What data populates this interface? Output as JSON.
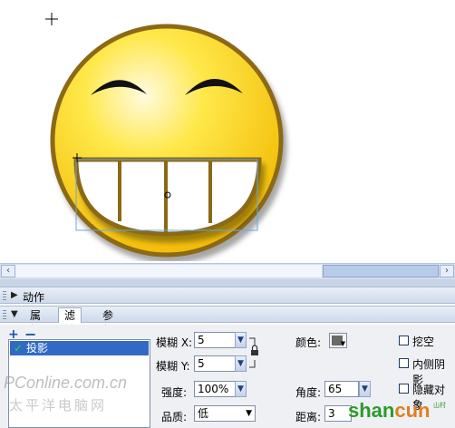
{
  "stage": {
    "selection_color": "#6aa9d9",
    "face_color": "#ffd700",
    "outline_color": "#8b6914"
  },
  "icons": {
    "crosshair": "crosshair-icon",
    "lock": "lock-icon"
  },
  "scrollbar": {
    "left_arrow": "‹",
    "right_arrow": "›"
  },
  "actions_panel": {
    "title": "动作"
  },
  "props_panel": {
    "tabs": [
      {
        "label": "属性",
        "active": false
      },
      {
        "label": "滤镜",
        "active": true
      },
      {
        "label": "参数",
        "active": false
      }
    ]
  },
  "filters": {
    "add": "+",
    "remove": "−",
    "list": [
      {
        "label": "投影",
        "enabled": true
      }
    ],
    "blur_x_label": "模糊 X:",
    "blur_x_value": "5",
    "blur_y_label": "模糊 Y:",
    "blur_y_value": "5",
    "strength_label": "强度:",
    "strength_value": "100%",
    "quality_label": "品质:",
    "quality_value": "低",
    "color_label": "颜色:",
    "color_value": "#6a6a6a",
    "angle_label": "角度:",
    "angle_value": "65",
    "distance_label": "距离:",
    "distance_value": "3",
    "knockout_label": "挖空",
    "inner_shadow_label": "内侧阴影",
    "hide_object_label": "隐藏对象"
  },
  "watermarks": {
    "pconline": "PConline.com.cn",
    "pconline_cn": "太平洋电脑网",
    "shancun_a": "shan",
    "shancun_b": "cun",
    "shancun_small": "山村"
  }
}
